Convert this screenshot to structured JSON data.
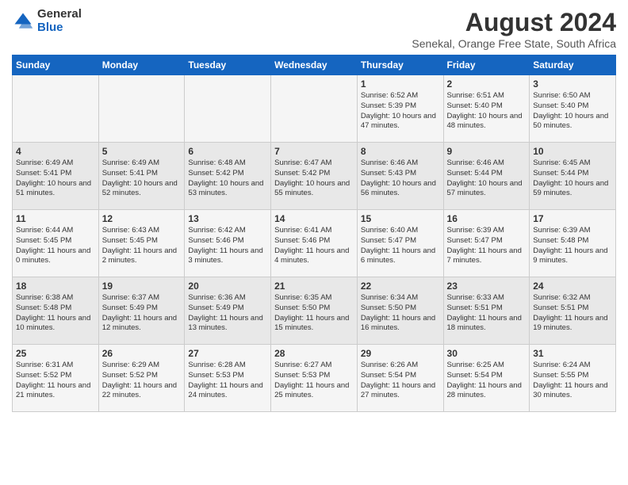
{
  "logo": {
    "general": "General",
    "blue": "Blue"
  },
  "title": "August 2024",
  "subtitle": "Senekal, Orange Free State, South Africa",
  "days_of_week": [
    "Sunday",
    "Monday",
    "Tuesday",
    "Wednesday",
    "Thursday",
    "Friday",
    "Saturday"
  ],
  "weeks": [
    [
      {
        "day": "",
        "content": ""
      },
      {
        "day": "",
        "content": ""
      },
      {
        "day": "",
        "content": ""
      },
      {
        "day": "",
        "content": ""
      },
      {
        "day": "1",
        "content": "Sunrise: 6:52 AM\nSunset: 5:39 PM\nDaylight: 10 hours and 47 minutes."
      },
      {
        "day": "2",
        "content": "Sunrise: 6:51 AM\nSunset: 5:40 PM\nDaylight: 10 hours and 48 minutes."
      },
      {
        "day": "3",
        "content": "Sunrise: 6:50 AM\nSunset: 5:40 PM\nDaylight: 10 hours and 50 minutes."
      }
    ],
    [
      {
        "day": "4",
        "content": "Sunrise: 6:49 AM\nSunset: 5:41 PM\nDaylight: 10 hours and 51 minutes."
      },
      {
        "day": "5",
        "content": "Sunrise: 6:49 AM\nSunset: 5:41 PM\nDaylight: 10 hours and 52 minutes."
      },
      {
        "day": "6",
        "content": "Sunrise: 6:48 AM\nSunset: 5:42 PM\nDaylight: 10 hours and 53 minutes."
      },
      {
        "day": "7",
        "content": "Sunrise: 6:47 AM\nSunset: 5:42 PM\nDaylight: 10 hours and 55 minutes."
      },
      {
        "day": "8",
        "content": "Sunrise: 6:46 AM\nSunset: 5:43 PM\nDaylight: 10 hours and 56 minutes."
      },
      {
        "day": "9",
        "content": "Sunrise: 6:46 AM\nSunset: 5:44 PM\nDaylight: 10 hours and 57 minutes."
      },
      {
        "day": "10",
        "content": "Sunrise: 6:45 AM\nSunset: 5:44 PM\nDaylight: 10 hours and 59 minutes."
      }
    ],
    [
      {
        "day": "11",
        "content": "Sunrise: 6:44 AM\nSunset: 5:45 PM\nDaylight: 11 hours and 0 minutes."
      },
      {
        "day": "12",
        "content": "Sunrise: 6:43 AM\nSunset: 5:45 PM\nDaylight: 11 hours and 2 minutes."
      },
      {
        "day": "13",
        "content": "Sunrise: 6:42 AM\nSunset: 5:46 PM\nDaylight: 11 hours and 3 minutes."
      },
      {
        "day": "14",
        "content": "Sunrise: 6:41 AM\nSunset: 5:46 PM\nDaylight: 11 hours and 4 minutes."
      },
      {
        "day": "15",
        "content": "Sunrise: 6:40 AM\nSunset: 5:47 PM\nDaylight: 11 hours and 6 minutes."
      },
      {
        "day": "16",
        "content": "Sunrise: 6:39 AM\nSunset: 5:47 PM\nDaylight: 11 hours and 7 minutes."
      },
      {
        "day": "17",
        "content": "Sunrise: 6:39 AM\nSunset: 5:48 PM\nDaylight: 11 hours and 9 minutes."
      }
    ],
    [
      {
        "day": "18",
        "content": "Sunrise: 6:38 AM\nSunset: 5:48 PM\nDaylight: 11 hours and 10 minutes."
      },
      {
        "day": "19",
        "content": "Sunrise: 6:37 AM\nSunset: 5:49 PM\nDaylight: 11 hours and 12 minutes."
      },
      {
        "day": "20",
        "content": "Sunrise: 6:36 AM\nSunset: 5:49 PM\nDaylight: 11 hours and 13 minutes."
      },
      {
        "day": "21",
        "content": "Sunrise: 6:35 AM\nSunset: 5:50 PM\nDaylight: 11 hours and 15 minutes."
      },
      {
        "day": "22",
        "content": "Sunrise: 6:34 AM\nSunset: 5:50 PM\nDaylight: 11 hours and 16 minutes."
      },
      {
        "day": "23",
        "content": "Sunrise: 6:33 AM\nSunset: 5:51 PM\nDaylight: 11 hours and 18 minutes."
      },
      {
        "day": "24",
        "content": "Sunrise: 6:32 AM\nSunset: 5:51 PM\nDaylight: 11 hours and 19 minutes."
      }
    ],
    [
      {
        "day": "25",
        "content": "Sunrise: 6:31 AM\nSunset: 5:52 PM\nDaylight: 11 hours and 21 minutes."
      },
      {
        "day": "26",
        "content": "Sunrise: 6:29 AM\nSunset: 5:52 PM\nDaylight: 11 hours and 22 minutes."
      },
      {
        "day": "27",
        "content": "Sunrise: 6:28 AM\nSunset: 5:53 PM\nDaylight: 11 hours and 24 minutes."
      },
      {
        "day": "28",
        "content": "Sunrise: 6:27 AM\nSunset: 5:53 PM\nDaylight: 11 hours and 25 minutes."
      },
      {
        "day": "29",
        "content": "Sunrise: 6:26 AM\nSunset: 5:54 PM\nDaylight: 11 hours and 27 minutes."
      },
      {
        "day": "30",
        "content": "Sunrise: 6:25 AM\nSunset: 5:54 PM\nDaylight: 11 hours and 28 minutes."
      },
      {
        "day": "31",
        "content": "Sunrise: 6:24 AM\nSunset: 5:55 PM\nDaylight: 11 hours and 30 minutes."
      }
    ]
  ]
}
